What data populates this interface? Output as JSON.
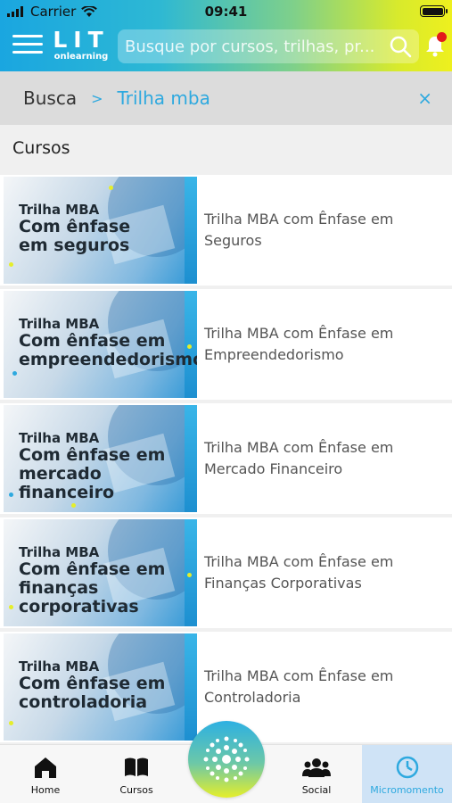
{
  "status_bar": {
    "carrier": "Carrier",
    "time": "09:41"
  },
  "header": {
    "logo_main": "LIT",
    "logo_sub": "onlearning",
    "search_placeholder": "Busque por cursos, trilhas, pr..."
  },
  "breadcrumb": {
    "root": "Busca",
    "separator": ">",
    "current": "Trilha mba",
    "close": "×"
  },
  "section_title": "Cursos",
  "courses": [
    {
      "thumb_kicker": "Trilha MBA",
      "thumb_title": "Com ênfase em seguros",
      "name": "Trilha MBA com Ênfase em Seguros"
    },
    {
      "thumb_kicker": "Trilha MBA",
      "thumb_title": "Com ênfase em empreendedorismo",
      "name": "Trilha MBA com Ênfase em Empreendedorismo"
    },
    {
      "thumb_kicker": "Trilha MBA",
      "thumb_title": "Com ênfase em mercado financeiro",
      "name": "Trilha MBA com Ênfase em Mercado Financeiro"
    },
    {
      "thumb_kicker": "Trilha MBA",
      "thumb_title": "Com ênfase em finanças corporativas",
      "name": "Trilha MBA com Ênfase em Finanças Corporativas"
    },
    {
      "thumb_kicker": "Trilha MBA",
      "thumb_title": "Com ênfase em controladoria",
      "name": "Trilha MBA com Ênfase em Controladoria"
    }
  ],
  "tabbar": {
    "home": "Home",
    "cursos": "Cursos",
    "social": "Social",
    "micromomento": "Micromomento"
  },
  "colors": {
    "accent": "#2ea9df",
    "notification": "#e31b1b",
    "gradient_start": "#1aa6e0",
    "gradient_end": "#eef01e"
  }
}
